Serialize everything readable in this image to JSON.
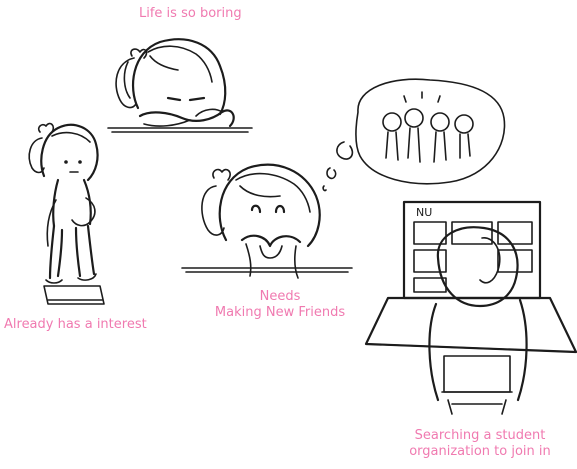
{
  "captions": {
    "boring": "Life is so boring",
    "interest": "Already has a interest",
    "needs_line1": "Needs",
    "needs_line2": "Making New Friends",
    "search_line1": "Searching a student",
    "search_line2": "organization to join in"
  },
  "board": {
    "label": "NU"
  },
  "colors": {
    "caption": "#f07ab0",
    "ink": "#1c1c1c",
    "background": "#ffffff"
  }
}
